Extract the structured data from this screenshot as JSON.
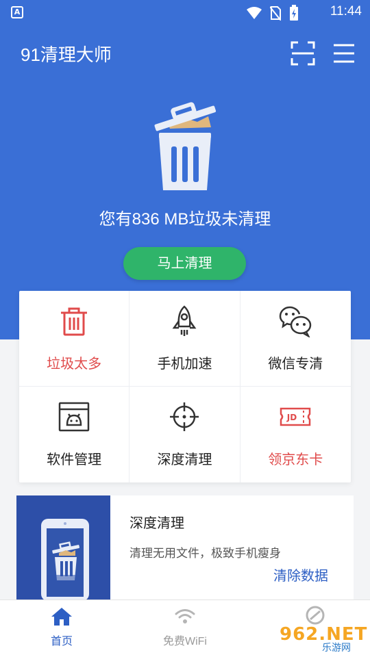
{
  "status_bar": {
    "time": "11:44",
    "notification_letter": "A"
  },
  "header": {
    "title": "91清理大师",
    "scan_icon": "scan-icon",
    "menu_icon": "menu-icon"
  },
  "hero": {
    "junk_text": "您有836 MB垃圾未清理",
    "junk_size": "836 MB",
    "clean_button": "马上清理"
  },
  "grid": {
    "items": [
      {
        "label": "垃圾太多",
        "icon": "trash-icon",
        "highlight": true
      },
      {
        "label": "手机加速",
        "icon": "rocket-icon",
        "highlight": false
      },
      {
        "label": "微信专清",
        "icon": "wechat-icon",
        "highlight": false
      },
      {
        "label": "软件管理",
        "icon": "android-box-icon",
        "highlight": false
      },
      {
        "label": "深度清理",
        "icon": "crosshair-icon",
        "highlight": false
      },
      {
        "label": "领京东卡",
        "icon": "jd-card-icon",
        "highlight": true,
        "icon_text": "JD"
      }
    ]
  },
  "promo": {
    "title": "深度清理",
    "description": "清理无用文件，极致手机瘦身",
    "link": "清除数据"
  },
  "bottom_nav": {
    "items": [
      {
        "label": "首页",
        "icon": "home-icon",
        "active": true
      },
      {
        "label": "免费WiFi",
        "icon": "wifi-icon",
        "active": false
      },
      {
        "label": "",
        "icon": "discover-icon",
        "active": false
      }
    ]
  },
  "watermark": {
    "text": "962.NET",
    "sub": "乐游网"
  },
  "colors": {
    "primary_blue": "#3a6fd6",
    "green": "#2fb46a",
    "red": "#e04b4b",
    "link_blue": "#2d5fc4"
  }
}
